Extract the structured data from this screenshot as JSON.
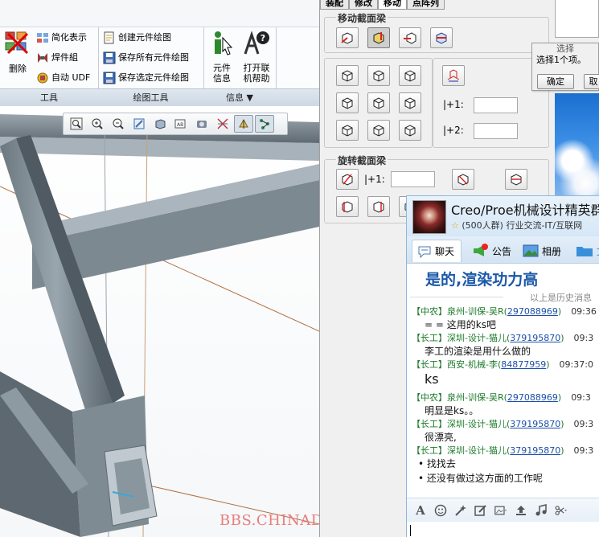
{
  "ribbon": {
    "tool_items": [
      "简化表示",
      "焊件組",
      "自动 UDF"
    ],
    "delete_label": "删除",
    "drawing_items": [
      "创建元件绘图",
      "保存所有元件绘图",
      "保存选定元件绘图"
    ],
    "info_items": [
      {
        "label": "元件\n信息"
      },
      {
        "label": "打开联\n机帮助"
      }
    ],
    "groups": [
      "工具",
      "绘图工具",
      "信息 ▼"
    ]
  },
  "view_toolbar": {
    "buttons": [
      "zoom-fit-icon",
      "zoom-in-icon",
      "zoom-out-icon",
      "repaint-icon",
      "display-style-icon",
      "saved-views-icon",
      "datum-display-icon",
      "spin-center-icon",
      "annotation-display-icon",
      "network-icon"
    ]
  },
  "watermark": "BBS.CHINADE.NET",
  "dialog": {
    "tabs": [
      "装配",
      "修改",
      "移动",
      "点阵列"
    ],
    "active_tab": "移动",
    "move_section": "移动截面梁",
    "rotate_section": "旋转截面梁",
    "offset1_label": "|+1:",
    "offset2_label": "|+2:",
    "rotate_offset_label": "|+1:"
  },
  "select_dialog": {
    "title": "选择",
    "message": "选择1个项。",
    "ok": "确定",
    "cancel": "取"
  },
  "chat": {
    "group_name": "Creo/Proe机械设计精英群",
    "group_info": "(500人群) 行业交流-IT/互联网",
    "tabs": [
      "聊天",
      "公告",
      "相册",
      "文"
    ],
    "big_message": "是的,渲染功力高",
    "history_label": "以上是历史消息",
    "messages": [
      {
        "tag": "【中农】",
        "name": "泉州-训保-吴R",
        "qq": "297088969",
        "time": "09:36",
        "text": "= = 这用的ks吧"
      },
      {
        "tag": "【长工】",
        "name": "深圳-设计-猫儿",
        "qq": "379195870",
        "time": "09:3",
        "text": "李工的渲染是用什么做的"
      },
      {
        "tag": "【长工】",
        "name": "西安-机械-李",
        "qq": "84877959",
        "time": "09:37:0",
        "text": "ks"
      },
      {
        "tag": "【中农】",
        "name": "泉州-训保-吴R",
        "qq": "297088969",
        "time": "09:3",
        "text": "明显是ks。。"
      },
      {
        "tag": "【长工】",
        "name": "深圳-设计-猫儿",
        "qq": "379195870",
        "time": "09:3",
        "text": "很漂亮,"
      },
      {
        "tag": "【长工】",
        "name": "深圳-设计-猫儿",
        "qq": "379195870",
        "time": "09:3",
        "text": "找找去"
      },
      {
        "tag": "",
        "name": "",
        "qq": "",
        "time": "",
        "text": "还没有做过这方面的工作呢"
      }
    ],
    "tools": [
      "font-icon",
      "emoji-icon",
      "magic-icon",
      "edit-icon",
      "image-icon",
      "upload-icon",
      "music-icon",
      "scissors-icon"
    ]
  }
}
